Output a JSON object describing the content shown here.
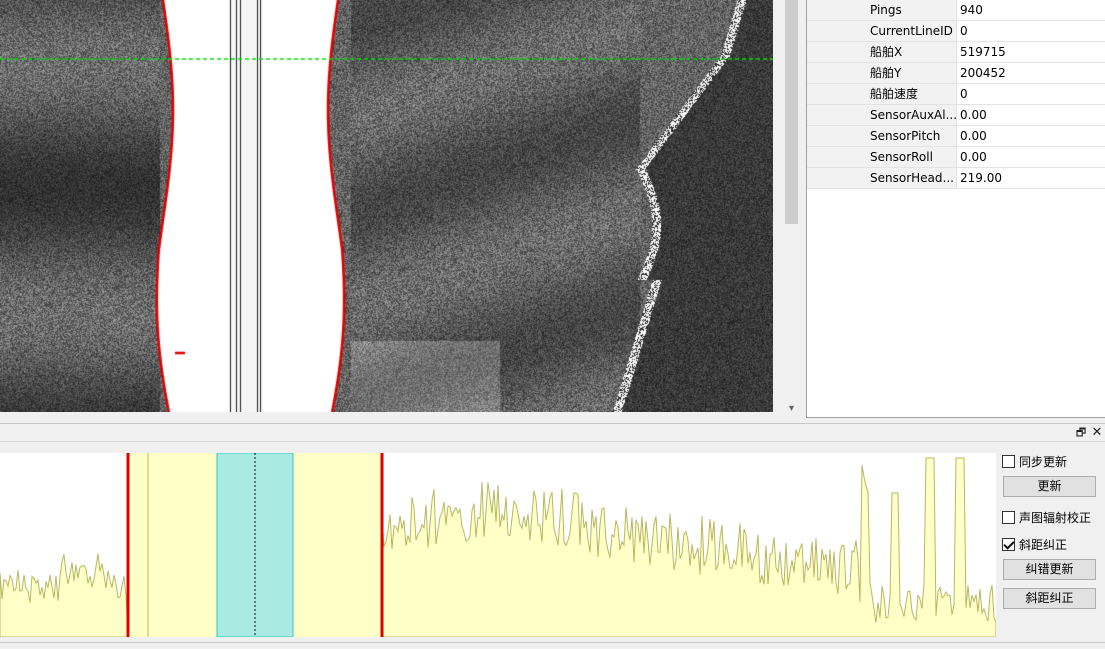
{
  "properties": [
    {
      "key": "Pings",
      "value": "940"
    },
    {
      "key": "CurrentLineID",
      "value": "0"
    },
    {
      "key": "船舶X",
      "value": "519715"
    },
    {
      "key": "船舶Y",
      "value": "200452"
    },
    {
      "key": "船舶速度",
      "value": "0"
    },
    {
      "key": "SensorAuxAl...",
      "value": "0.00"
    },
    {
      "key": "SensorPitch",
      "value": "0.00"
    },
    {
      "key": "SensorRoll",
      "value": "0.00"
    },
    {
      "key": "SensorHead...",
      "value": "219.00"
    }
  ],
  "icons": {
    "scroll_down": "▾",
    "float": "🗗",
    "close": "✕"
  },
  "controls": {
    "sync_update": {
      "label": "同步更新",
      "checked": false
    },
    "update_button": "更新",
    "radiometric_correction": {
      "label": "声图辐射校正",
      "checked": false
    },
    "slant_range_correction": {
      "label": "斜距纠正",
      "checked": true
    },
    "error_correction_update_button": "纠错更新",
    "slant_range_correction_button": "斜距纠正"
  },
  "colors": {
    "sonar_background": "#101010",
    "bottom_track": "#e00000",
    "cursor_line": "#00e000",
    "profile_fill": "#ffffc8",
    "profile_line": "#b8b860",
    "selection_band": "#9ae8e8",
    "selection_border": "#30c8c8"
  }
}
